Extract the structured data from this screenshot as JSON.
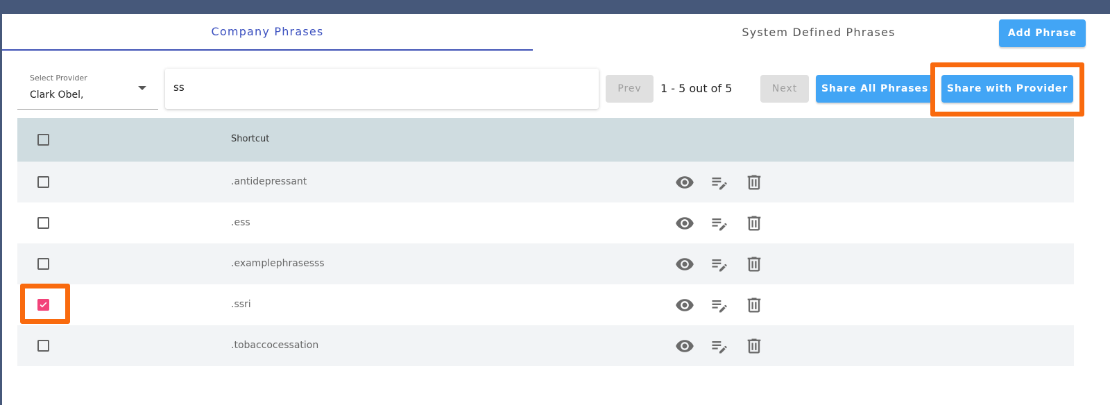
{
  "tabs": {
    "company": "Company Phrases",
    "system": "System Defined Phrases"
  },
  "toolbar": {
    "add_phrase": "Add Phrase",
    "prev": "Prev",
    "next": "Next",
    "share_all": "Share All Phrases",
    "share_provider": "Share with Provider",
    "page_info": "1 - 5 out of 5"
  },
  "provider_select": {
    "label": "Select Provider",
    "value": "Clark Obel,"
  },
  "search": {
    "value": "ss"
  },
  "table": {
    "header_shortcut": "Shortcut",
    "rows": [
      {
        "shortcut": ".antidepressant",
        "checked": false
      },
      {
        "shortcut": ".ess",
        "checked": false
      },
      {
        "shortcut": ".examplephrasesss",
        "checked": false
      },
      {
        "shortcut": ".ssri",
        "checked": true
      },
      {
        "shortcut": ".tobaccocessation",
        "checked": false
      }
    ]
  },
  "colors": {
    "header_bar": "#46587a",
    "accent_blue": "#42a5f5",
    "tab_active": "#3f51b5",
    "checkbox_checked": "#f2437a",
    "highlight": "#f96a0e"
  }
}
